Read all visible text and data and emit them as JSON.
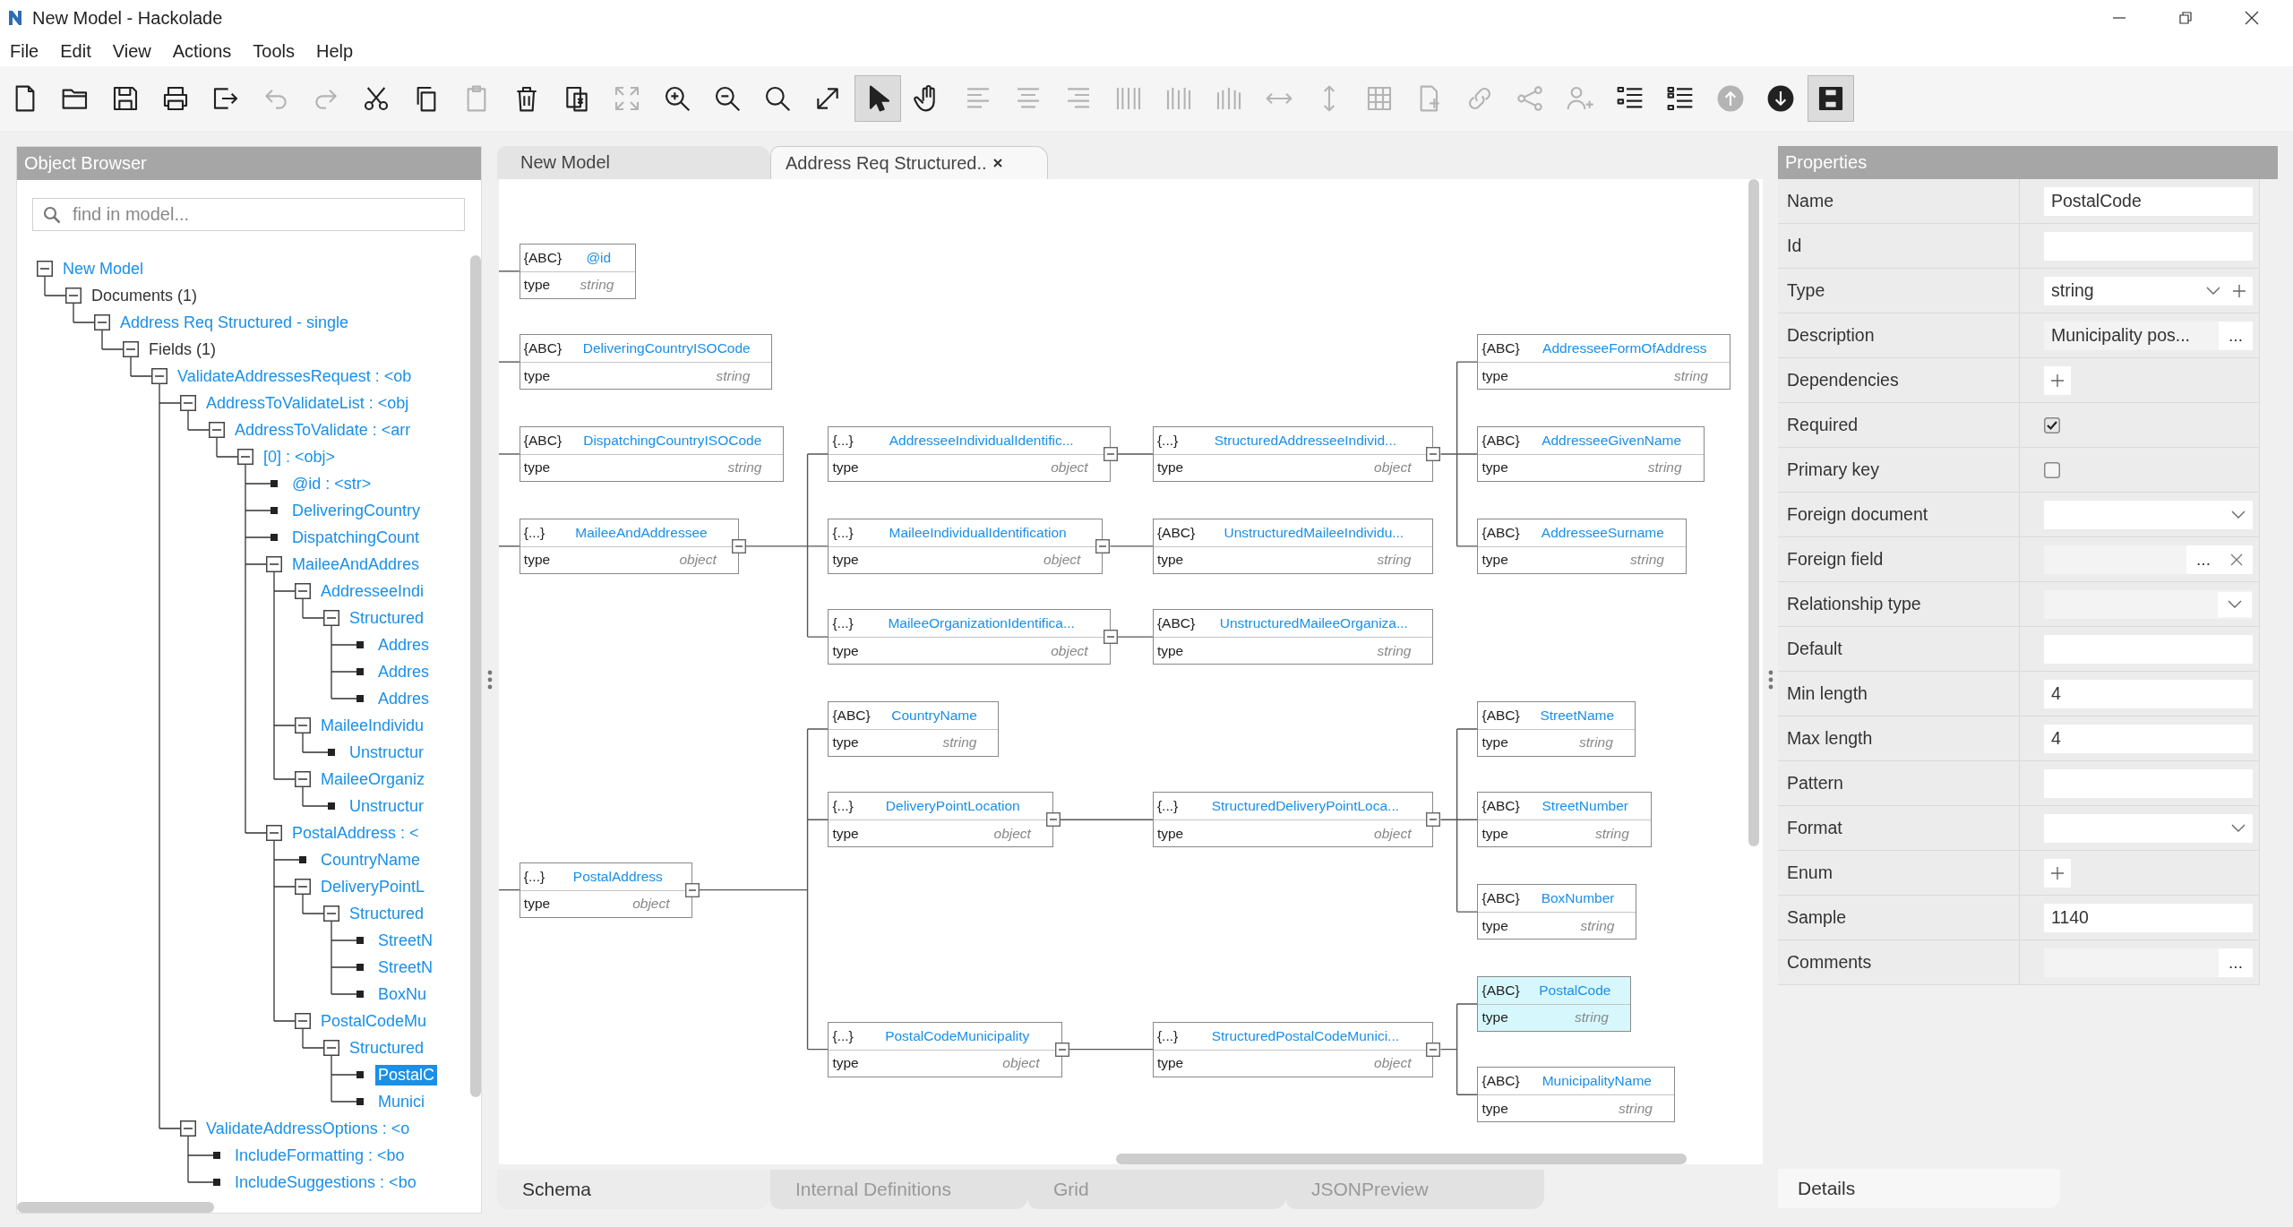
{
  "window": {
    "title": "New Model - Hackolade"
  },
  "menu": [
    "File",
    "Edit",
    "View",
    "Actions",
    "Tools",
    "Help"
  ],
  "toolbar": [
    {
      "kind": "new",
      "disabled": false,
      "selected": false
    },
    {
      "kind": "open",
      "disabled": false,
      "selected": false
    },
    {
      "kind": "save",
      "disabled": false,
      "selected": false
    },
    {
      "kind": "print",
      "disabled": false,
      "selected": false
    },
    {
      "kind": "export",
      "disabled": false,
      "selected": false
    },
    {
      "kind": "undo",
      "disabled": true,
      "selected": false
    },
    {
      "kind": "redo",
      "disabled": true,
      "selected": false
    },
    {
      "kind": "cut",
      "disabled": false,
      "selected": false
    },
    {
      "kind": "copy",
      "disabled": false,
      "selected": false
    },
    {
      "kind": "paste",
      "disabled": true,
      "selected": false
    },
    {
      "kind": "delete",
      "disabled": false,
      "selected": false
    },
    {
      "kind": "paste_special",
      "disabled": false,
      "selected": false
    },
    {
      "kind": "fit",
      "disabled": true,
      "selected": false
    },
    {
      "kind": "zoom_in",
      "disabled": false,
      "selected": false
    },
    {
      "kind": "zoom_out",
      "disabled": false,
      "selected": false
    },
    {
      "kind": "zoom",
      "disabled": false,
      "selected": false
    },
    {
      "kind": "expand",
      "disabled": false,
      "selected": false
    },
    {
      "kind": "pointer",
      "disabled": false,
      "selected": true
    },
    {
      "kind": "hand",
      "disabled": false,
      "selected": false
    },
    {
      "kind": "align_left",
      "disabled": true,
      "selected": false
    },
    {
      "kind": "align_center",
      "disabled": true,
      "selected": false
    },
    {
      "kind": "align_right",
      "disabled": true,
      "selected": false
    },
    {
      "kind": "distribute_left",
      "disabled": true,
      "selected": false
    },
    {
      "kind": "distribute_center",
      "disabled": true,
      "selected": false
    },
    {
      "kind": "distribute_right",
      "disabled": true,
      "selected": false
    },
    {
      "kind": "h_arrow",
      "disabled": true,
      "selected": false
    },
    {
      "kind": "v_arrow",
      "disabled": true,
      "selected": false
    },
    {
      "kind": "grid",
      "disabled": true,
      "selected": false
    },
    {
      "kind": "add_page",
      "disabled": true,
      "selected": false
    },
    {
      "kind": "link",
      "disabled": true,
      "selected": false
    },
    {
      "kind": "share",
      "disabled": true,
      "selected": false
    },
    {
      "kind": "add_user",
      "disabled": true,
      "selected": false
    },
    {
      "kind": "list",
      "disabled": false,
      "selected": false
    },
    {
      "kind": "list_alt",
      "disabled": false,
      "selected": false
    },
    {
      "kind": "move_up",
      "disabled": true,
      "selected": false
    },
    {
      "kind": "move_down",
      "disabled": false,
      "selected": false
    },
    {
      "kind": "storage",
      "disabled": false,
      "selected": true
    }
  ],
  "object_browser": {
    "title": "Object Browser",
    "search": {
      "placeholder": "find in model..."
    },
    "tree": [
      {
        "label": "New Model",
        "kind": "object",
        "expanded": true,
        "selected": false,
        "children": [
          {
            "label": "Documents (1)",
            "kind": "category",
            "expanded": true,
            "selected": false,
            "children": [
              {
                "label": "Address Req Structured - single",
                "kind": "object",
                "expanded": true,
                "selected": false,
                "children": [
                  {
                    "label": "Fields (1)",
                    "kind": "category",
                    "expanded": true,
                    "selected": false,
                    "children": [
                      {
                        "label": "ValidateAddressesRequest : <ob",
                        "kind": "object",
                        "expanded": true,
                        "selected": false,
                        "children": [
                          {
                            "label": "AddressToValidateList : <obj",
                            "kind": "object",
                            "expanded": true,
                            "selected": false,
                            "children": [
                              {
                                "label": "AddressToValidate : <arr",
                                "kind": "object",
                                "expanded": true,
                                "selected": false,
                                "children": [
                                  {
                                    "label": "[0] : <obj>",
                                    "kind": "object",
                                    "expanded": true,
                                    "selected": false,
                                    "children": [
                                      {
                                        "label": "@id : <str>",
                                        "kind": "field",
                                        "selected": false
                                      },
                                      {
                                        "label": "DeliveringCountry",
                                        "kind": "field",
                                        "selected": false
                                      },
                                      {
                                        "label": "DispatchingCount",
                                        "kind": "field",
                                        "selected": false
                                      },
                                      {
                                        "label": "MaileeAndAddres",
                                        "kind": "object",
                                        "expanded": true,
                                        "selected": false,
                                        "children": [
                                          {
                                            "label": "AddresseeIndi",
                                            "kind": "object",
                                            "expanded": true,
                                            "selected": false,
                                            "children": [
                                              {
                                                "label": "Structured",
                                                "kind": "object",
                                                "expanded": true,
                                                "selected": false,
                                                "children": [
                                                  {
                                                    "label": "Addres",
                                                    "kind": "field",
                                                    "selected": false
                                                  },
                                                  {
                                                    "label": "Addres",
                                                    "kind": "field",
                                                    "selected": false
                                                  },
                                                  {
                                                    "label": "Addres",
                                                    "kind": "field",
                                                    "selected": false
                                                  }
                                                ]
                                              }
                                            ]
                                          },
                                          {
                                            "label": "MaileeIndividu",
                                            "kind": "object",
                                            "expanded": true,
                                            "selected": false,
                                            "children": [
                                              {
                                                "label": "Unstructur",
                                                "kind": "field",
                                                "selected": false
                                              }
                                            ]
                                          },
                                          {
                                            "label": "MaileeOrganiz",
                                            "kind": "object",
                                            "expanded": true,
                                            "selected": false,
                                            "children": [
                                              {
                                                "label": "Unstructur",
                                                "kind": "field",
                                                "selected": false
                                              }
                                            ]
                                          }
                                        ]
                                      },
                                      {
                                        "label": "PostalAddress : <",
                                        "kind": "object",
                                        "expanded": true,
                                        "selected": false,
                                        "children": [
                                          {
                                            "label": "CountryName",
                                            "kind": "field",
                                            "selected": false
                                          },
                                          {
                                            "label": "DeliveryPointL",
                                            "kind": "object",
                                            "expanded": true,
                                            "selected": false,
                                            "children": [
                                              {
                                                "label": "Structured",
                                                "kind": "object",
                                                "expanded": true,
                                                "selected": false,
                                                "children": [
                                                  {
                                                    "label": "StreetN",
                                                    "kind": "field",
                                                    "selected": false
                                                  },
                                                  {
                                                    "label": "StreetN",
                                                    "kind": "field",
                                                    "selected": false
                                                  },
                                                  {
                                                    "label": "BoxNu",
                                                    "kind": "field",
                                                    "selected": false
                                                  }
                                                ]
                                              }
                                            ]
                                          },
                                          {
                                            "label": "PostalCodeMu",
                                            "kind": "object",
                                            "expanded": true,
                                            "selected": false,
                                            "children": [
                                              {
                                                "label": "Structured",
                                                "kind": "object",
                                                "expanded": true,
                                                "selected": false,
                                                "children": [
                                                  {
                                                    "label": "PostalC",
                                                    "kind": "field",
                                                    "selected": true
                                                  },
                                                  {
                                                    "label": "Munici",
                                                    "kind": "field",
                                                    "selected": false
                                                  }
                                                ]
                                              }
                                            ]
                                          }
                                        ]
                                      }
                                    ]
                                  }
                                ]
                              }
                            ]
                          },
                          {
                            "label": "ValidateAddressOptions : <o",
                            "kind": "object",
                            "expanded": true,
                            "selected": false,
                            "children": [
                              {
                                "label": "IncludeFormatting : <bo",
                                "kind": "field",
                                "selected": false
                              },
                              {
                                "label": "IncludeSuggestions : <bo",
                                "kind": "field",
                                "selected": false
                              }
                            ]
                          }
                        ]
                      }
                    ]
                  }
                ]
              }
            ]
          }
        ]
      }
    ]
  },
  "diagram": {
    "tabs": [
      {
        "label": "New Model",
        "selected": false,
        "closable": false
      },
      {
        "label": "Address Req Structured..",
        "selected": true,
        "closable": true
      }
    ],
    "nodes": [
      {
        "icon": "{ABC}",
        "name": "@id",
        "type_label": "type",
        "type": "string",
        "kind": "field",
        "selected": false
      },
      {
        "icon": "{ABC}",
        "name": "DeliveringCountryISOCode",
        "type_label": "type",
        "type": "string",
        "kind": "field",
        "selected": false
      },
      {
        "icon": "{ABC}",
        "name": "DispatchingCountryISOCode",
        "type_label": "type",
        "type": "string",
        "kind": "field",
        "selected": false
      },
      {
        "icon": "{...}",
        "name": "MaileeAndAddressee",
        "type_label": "type",
        "type": "object",
        "kind": "object",
        "selected": false,
        "children": [
          {
            "icon": "{...}",
            "name": "AddresseeIndividualIdentific...",
            "type_label": "type",
            "type": "object",
            "kind": "object",
            "selected": false,
            "children": [
              {
                "icon": "{...}",
                "name": "StructuredAddresseeIndivid...",
                "type_label": "type",
                "type": "object",
                "kind": "object",
                "selected": false,
                "children": [
                  {
                    "icon": "{ABC}",
                    "name": "AddresseeFormOfAddress",
                    "type_label": "type",
                    "type": "string",
                    "kind": "field",
                    "selected": false
                  },
                  {
                    "icon": "{ABC}",
                    "name": "AddresseeGivenName",
                    "type_label": "type",
                    "type": "string",
                    "kind": "field",
                    "selected": false
                  },
                  {
                    "icon": "{ABC}",
                    "name": "AddresseeSurname",
                    "type_label": "type",
                    "type": "string",
                    "kind": "field",
                    "selected": false
                  }
                ]
              }
            ]
          },
          {
            "icon": "{...}",
            "name": "MaileeIndividualIdentification",
            "type_label": "type",
            "type": "object",
            "kind": "object",
            "selected": false,
            "children": [
              {
                "icon": "{ABC}",
                "name": "UnstructuredMaileeIndividu...",
                "type_label": "type",
                "type": "string",
                "kind": "field",
                "selected": false
              }
            ]
          },
          {
            "icon": "{...}",
            "name": "MaileeOrganizationIdentifica...",
            "type_label": "type",
            "type": "object",
            "kind": "object",
            "selected": false,
            "children": [
              {
                "icon": "{ABC}",
                "name": "UnstructuredMaileeOrganiza...",
                "type_label": "type",
                "type": "string",
                "kind": "field",
                "selected": false
              }
            ]
          }
        ]
      },
      {
        "icon": "{...}",
        "name": "PostalAddress",
        "type_label": "type",
        "type": "object",
        "kind": "object",
        "selected": false,
        "children": [
          {
            "icon": "{ABC}",
            "name": "CountryName",
            "type_label": "type",
            "type": "string",
            "kind": "field",
            "selected": false
          },
          {
            "icon": "{...}",
            "name": "DeliveryPointLocation",
            "type_label": "type",
            "type": "object",
            "kind": "object",
            "selected": false,
            "children": [
              {
                "icon": "{...}",
                "name": "StructuredDeliveryPointLoca...",
                "type_label": "type",
                "type": "object",
                "kind": "object",
                "selected": false,
                "children": [
                  {
                    "icon": "{ABC}",
                    "name": "StreetName",
                    "type_label": "type",
                    "type": "string",
                    "kind": "field",
                    "selected": false
                  },
                  {
                    "icon": "{ABC}",
                    "name": "StreetNumber",
                    "type_label": "type",
                    "type": "string",
                    "kind": "field",
                    "selected": false
                  },
                  {
                    "icon": "{ABC}",
                    "name": "BoxNumber",
                    "type_label": "type",
                    "type": "string",
                    "kind": "field",
                    "selected": false
                  }
                ]
              }
            ]
          },
          {
            "icon": "{...}",
            "name": "PostalCodeMunicipality",
            "type_label": "type",
            "type": "object",
            "kind": "object",
            "selected": false,
            "children": [
              {
                "icon": "{...}",
                "name": "StructuredPostalCodeMunici...",
                "type_label": "type",
                "type": "object",
                "kind": "object",
                "selected": false,
                "children": [
                  {
                    "icon": "{ABC}",
                    "name": "PostalCode",
                    "type_label": "type",
                    "type": "string",
                    "kind": "field",
                    "selected": true
                  },
                  {
                    "icon": "{ABC}",
                    "name": "MunicipalityName",
                    "type_label": "type",
                    "type": "string",
                    "kind": "field",
                    "selected": false
                  }
                ]
              }
            ]
          }
        ]
      }
    ],
    "view_tabs": [
      {
        "label": "Schema",
        "selected": true
      },
      {
        "label": "Internal Definitions",
        "selected": false
      },
      {
        "label": "Grid",
        "selected": false
      },
      {
        "label": "JSONPreview",
        "selected": false
      }
    ]
  },
  "properties": {
    "title": "Properties",
    "rows": [
      {
        "label": "Name",
        "kind": "text",
        "value": "PostalCode"
      },
      {
        "label": "Id",
        "kind": "text"
      },
      {
        "label": "Type",
        "kind": "type_select",
        "value": "string"
      },
      {
        "label": "Description",
        "kind": "text_more",
        "value": "Municipality pos...",
        "button": "..."
      },
      {
        "label": "Dependencies",
        "kind": "add"
      },
      {
        "label": "Required",
        "kind": "checkbox",
        "checked": true
      },
      {
        "label": "Primary key",
        "kind": "checkbox",
        "checked": false
      },
      {
        "label": "Foreign document",
        "kind": "select"
      },
      {
        "label": "Foreign field",
        "kind": "reference",
        "button": "..."
      },
      {
        "label": "Relationship type",
        "kind": "locked_select"
      },
      {
        "label": "Default",
        "kind": "text"
      },
      {
        "label": "Min length",
        "kind": "text",
        "value": "4"
      },
      {
        "label": "Max length",
        "kind": "text",
        "value": "4"
      },
      {
        "label": "Pattern",
        "kind": "text"
      },
      {
        "label": "Format",
        "kind": "select"
      },
      {
        "label": "Enum",
        "kind": "add"
      },
      {
        "label": "Sample",
        "kind": "text",
        "value": "1140"
      },
      {
        "label": "Comments",
        "kind": "memo",
        "button": "..."
      }
    ],
    "tabs": [
      {
        "label": "Details",
        "selected": true
      }
    ]
  }
}
